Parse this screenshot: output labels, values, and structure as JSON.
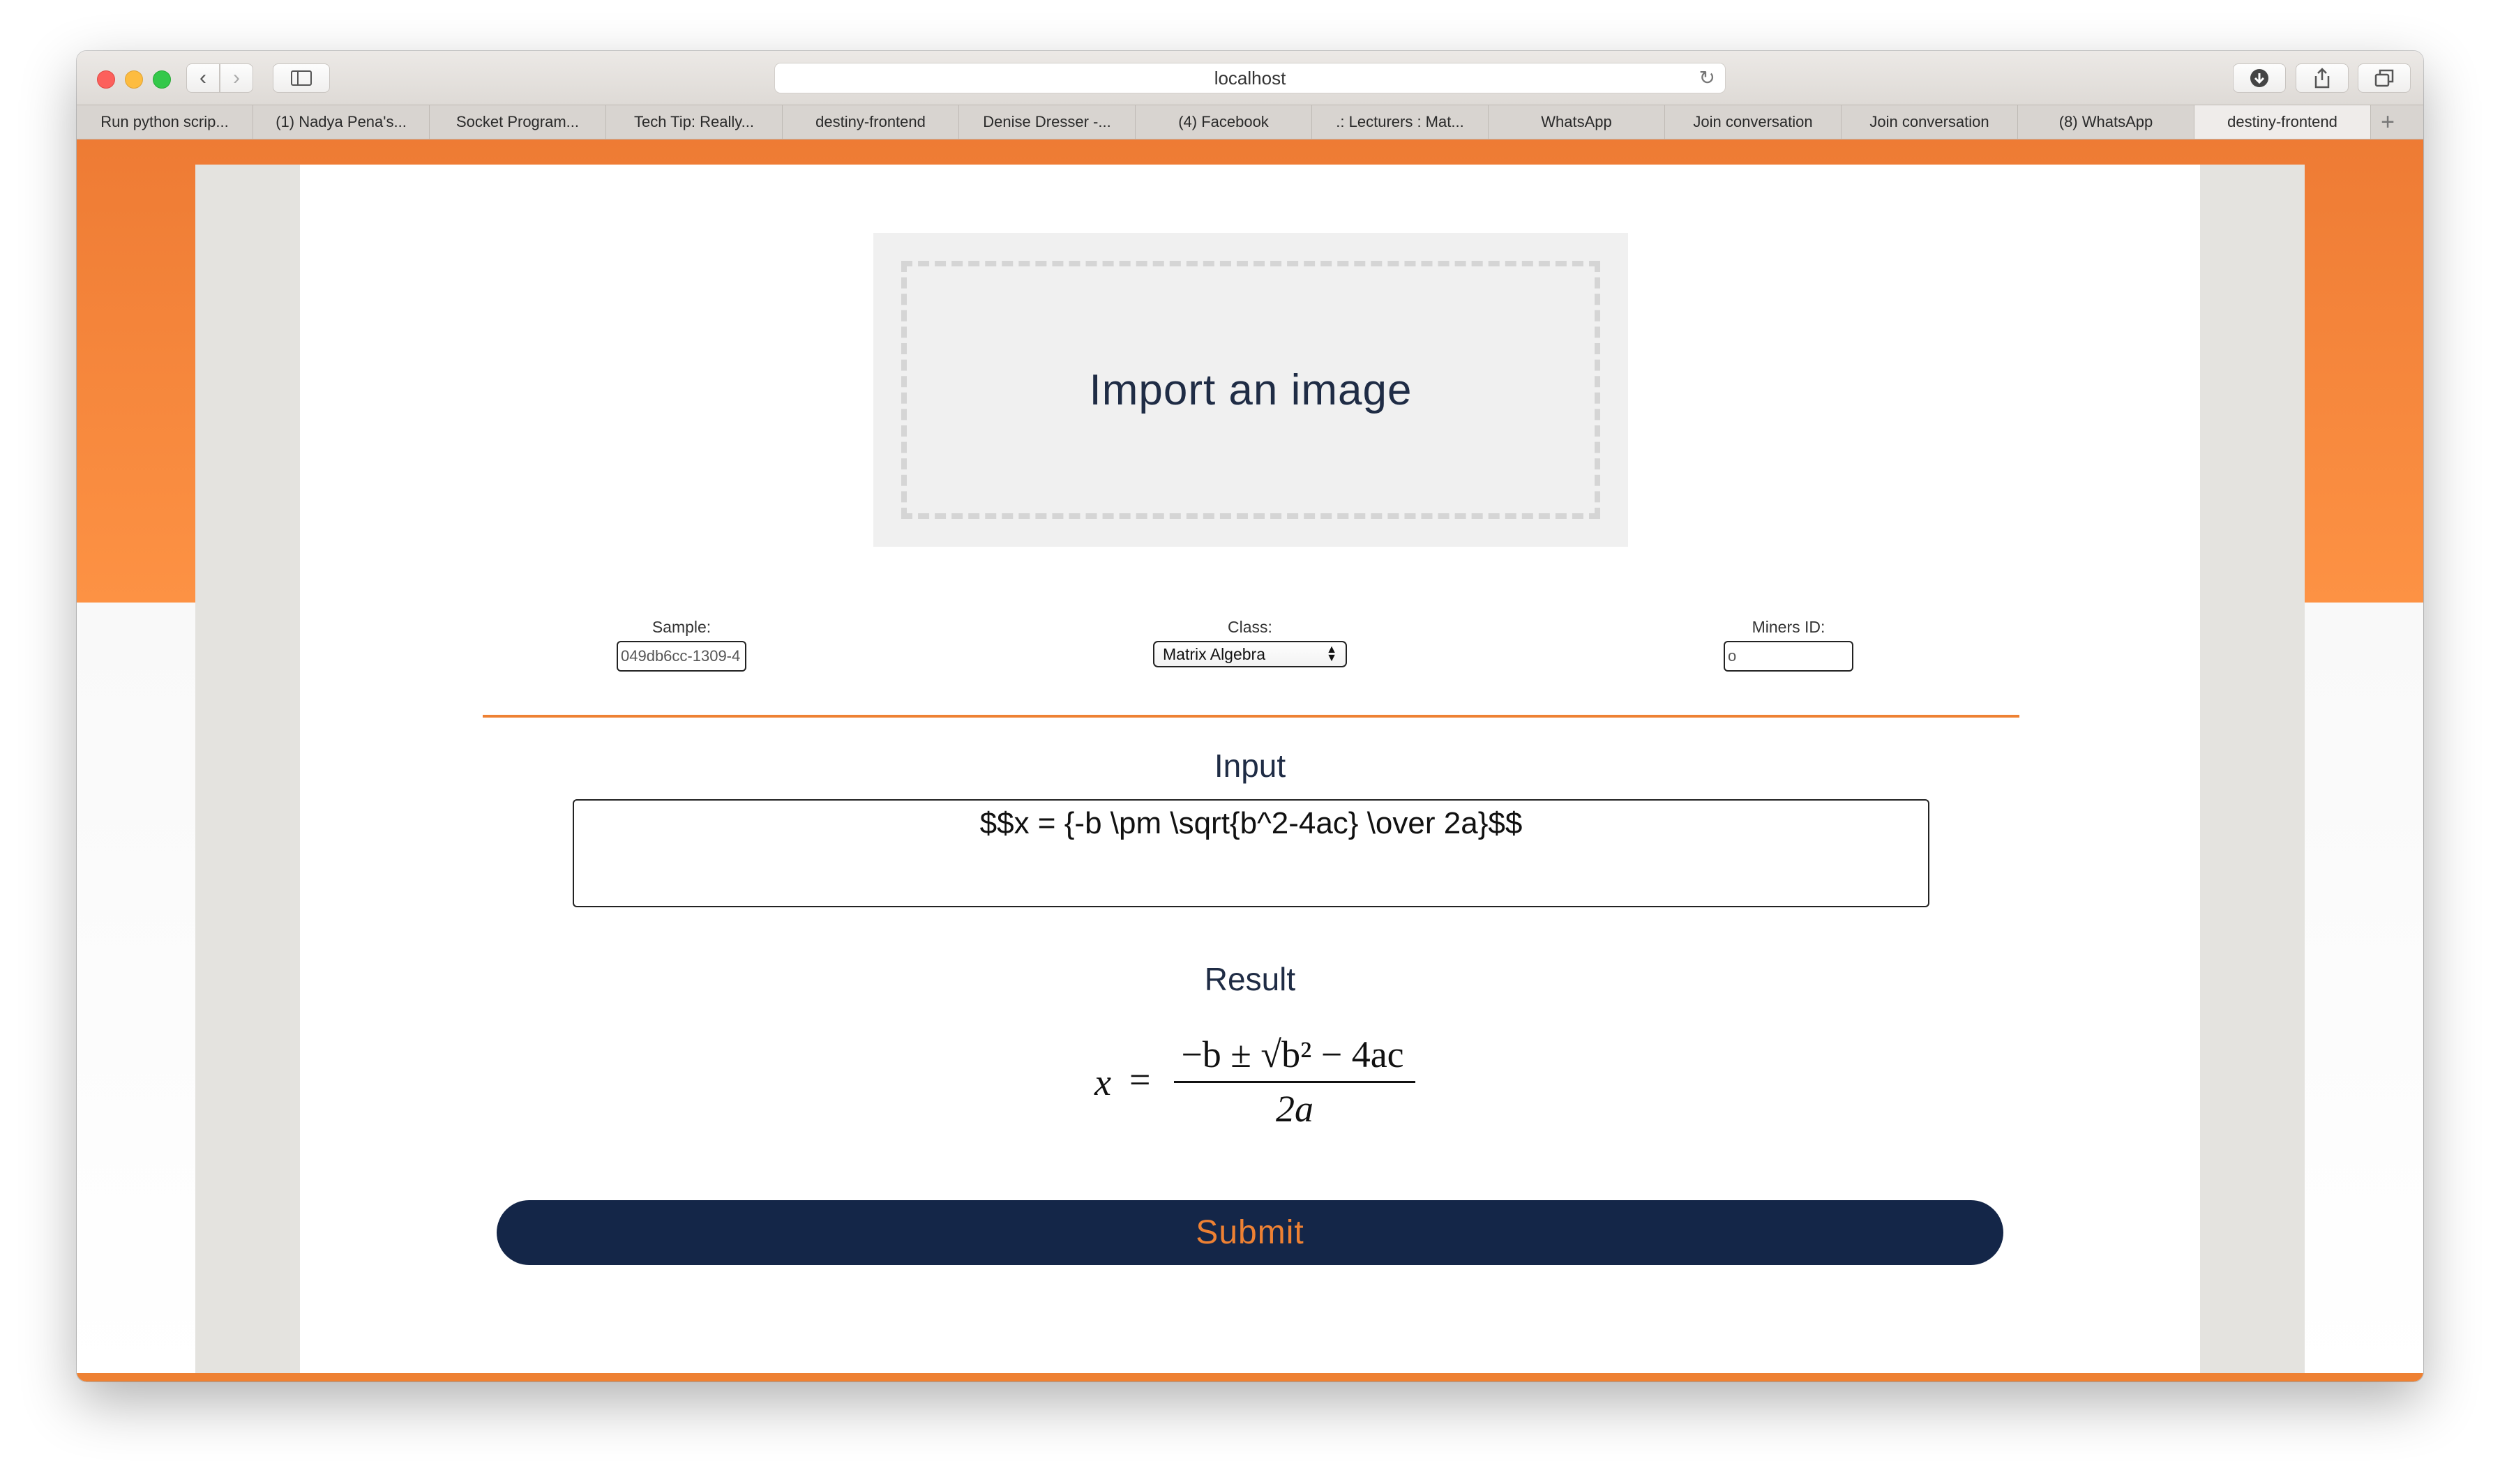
{
  "browser": {
    "url": "localhost",
    "tabs": [
      "Run python scrip...",
      "(1) Nadya Pena's...",
      "Socket Program...",
      "Tech Tip: Really...",
      "destiny-frontend",
      "Denise Dresser -...",
      "(4) Facebook",
      ".: Lecturers : Mat...",
      "WhatsApp",
      "Join conversation",
      "Join conversation",
      "(8) WhatsApp",
      "destiny-frontend"
    ],
    "active_tab_index": 12,
    "icons": {
      "back": "chevron-left-icon",
      "forward": "chevron-right-icon",
      "sidebar": "sidebar-icon",
      "reload": "reload-icon",
      "download": "download-icon",
      "share": "share-icon",
      "tabs": "tabs-overview-icon",
      "new_tab": "plus-icon"
    }
  },
  "app": {
    "dropzone_label": "Import an image",
    "fields": {
      "sample_label": "Sample:",
      "sample_value": "049db6cc-1309-4",
      "class_label": "Class:",
      "class_value": "Matrix Algebra",
      "miners_label": "Miners ID:",
      "miners_value": "o"
    },
    "input_title": "Input",
    "input_value": "$$x = {-b \\pm \\sqrt{b^2-4ac} \\over 2a}$$",
    "result_title": "Result",
    "formula": {
      "lhs": "x",
      "equals": "=",
      "numerator": "−b ± √b² − 4ac",
      "denominator": "2a"
    },
    "submit_label": "Submit"
  },
  "colors": {
    "accent_orange": "#ee8133",
    "navy": "#142648",
    "side_gray": "#e4e3df"
  }
}
